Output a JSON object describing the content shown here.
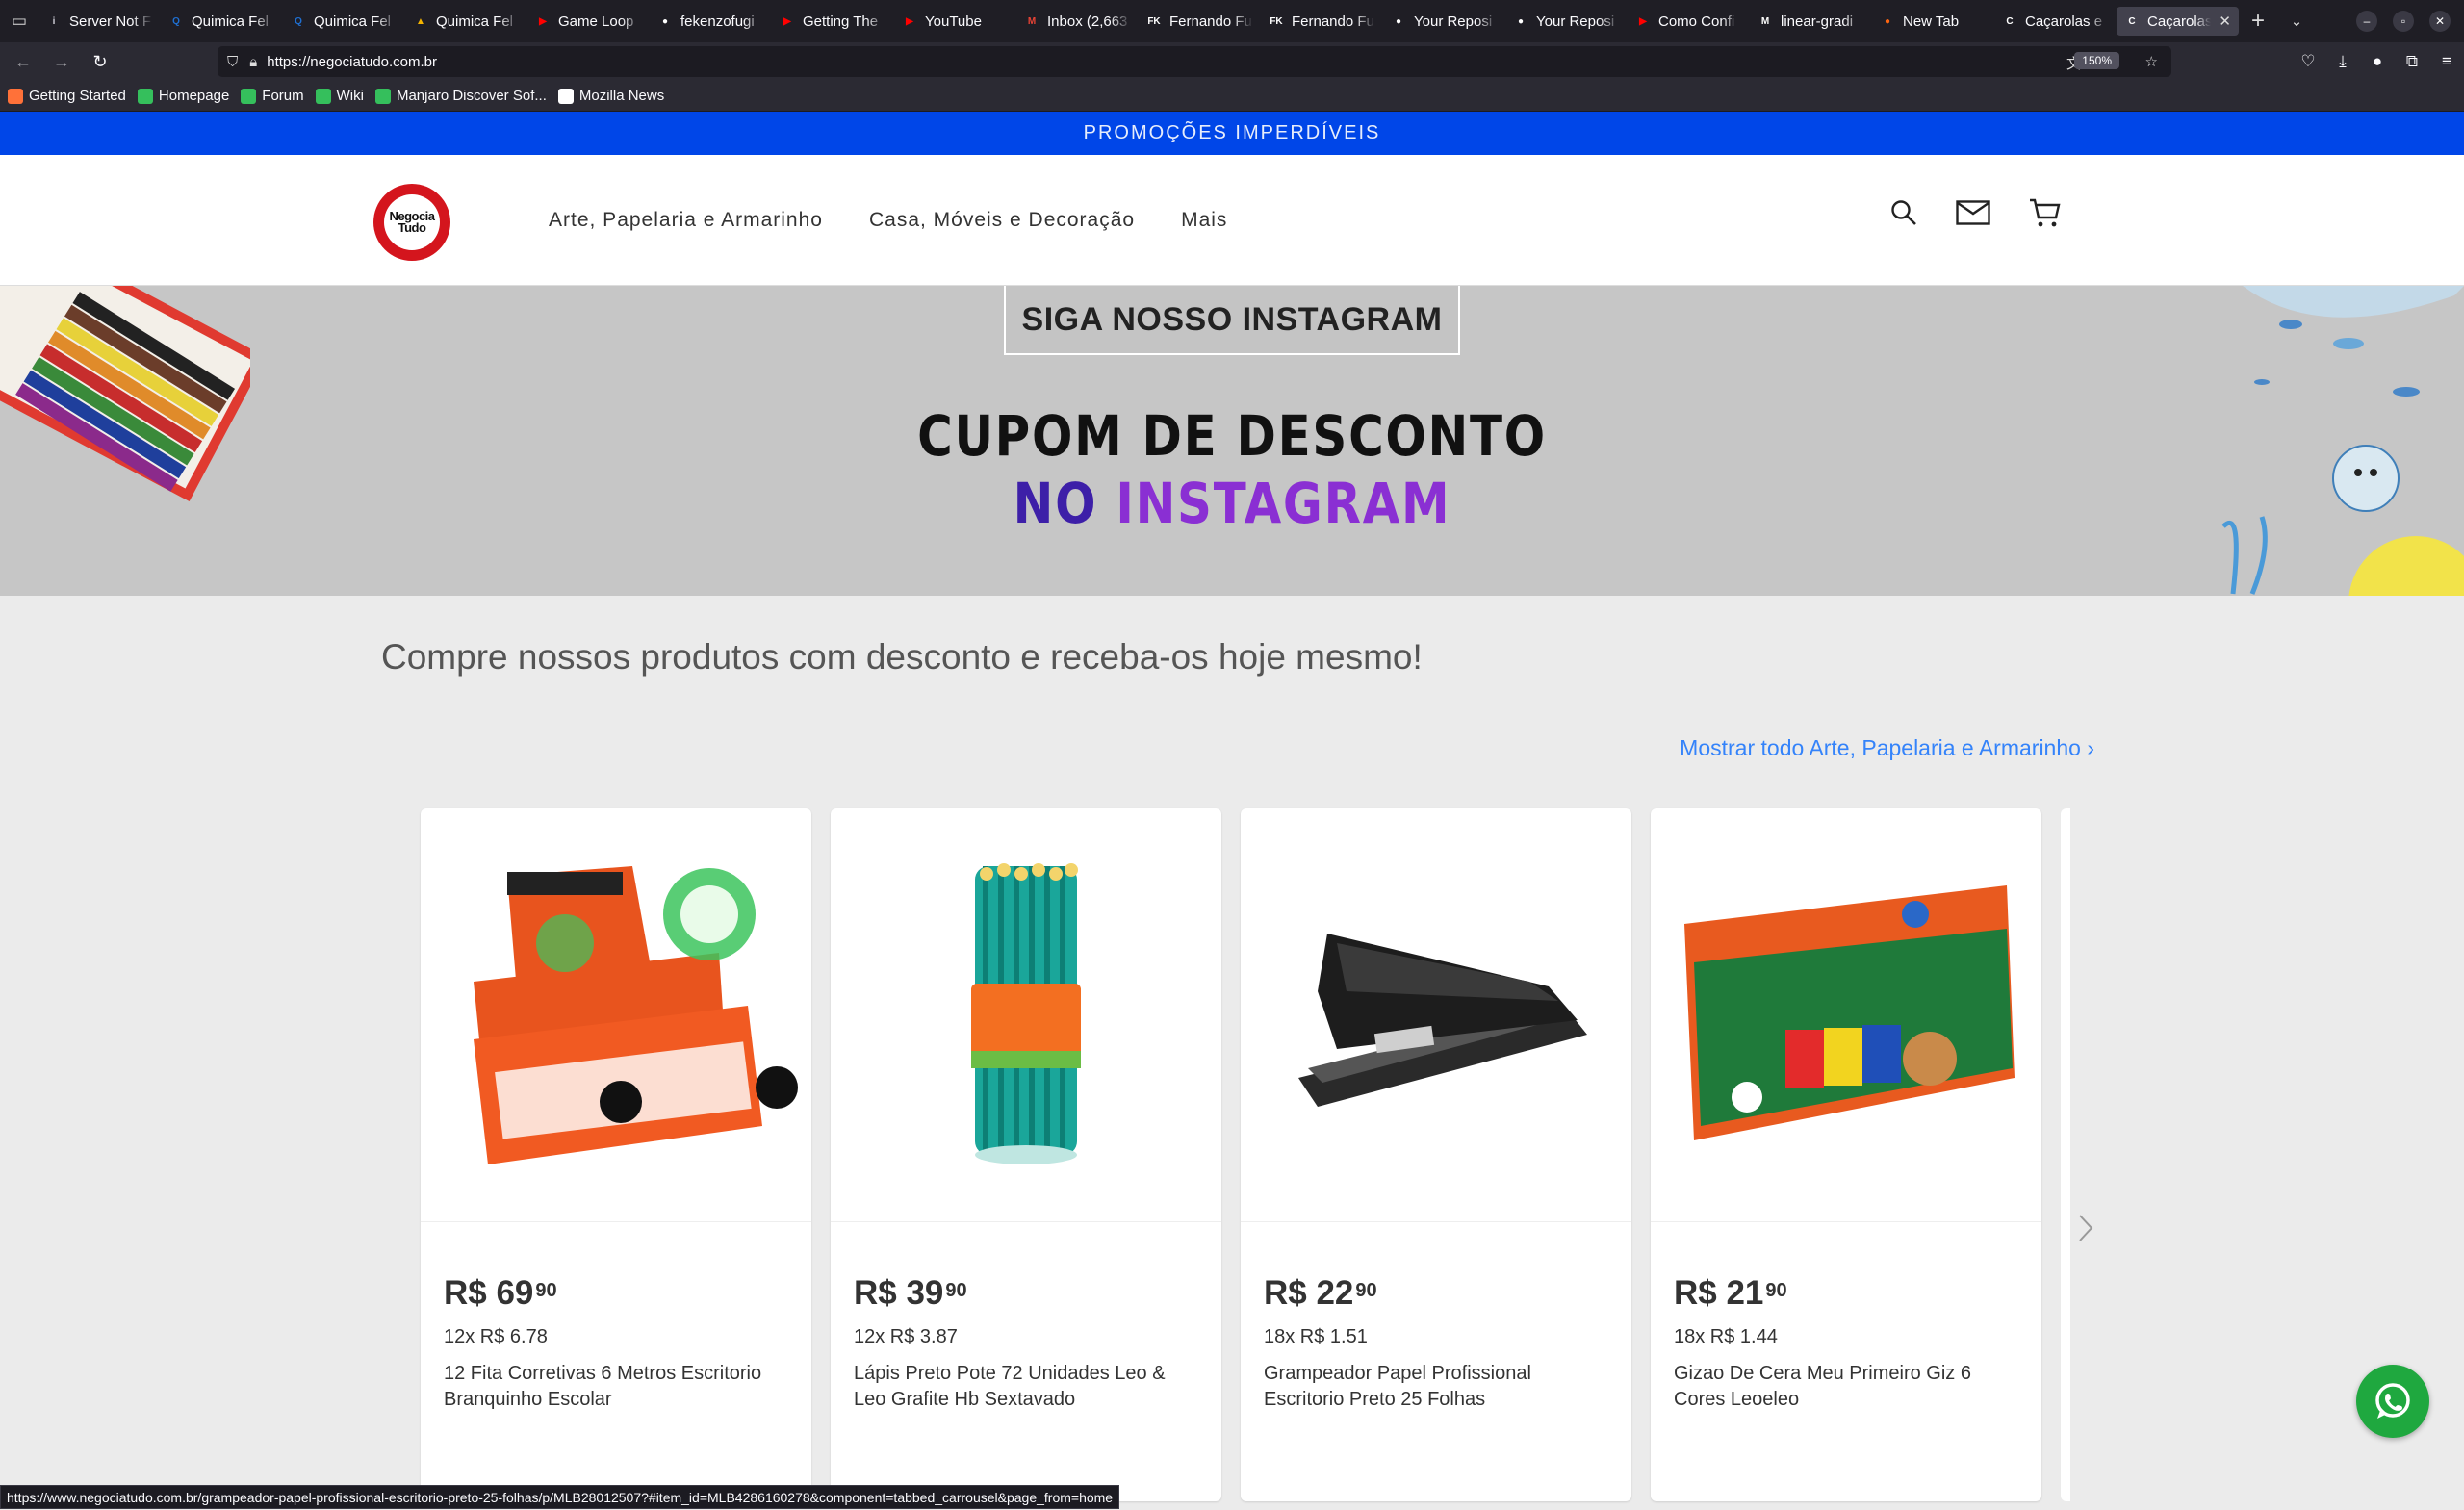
{
  "browser": {
    "tabs": [
      {
        "label": "Server Not F",
        "fav": "#cfcfd8",
        "glyph": "i"
      },
      {
        "label": "Quimica Fel",
        "fav": "#1f6fd1",
        "glyph": "Q"
      },
      {
        "label": "Quimica Fel",
        "fav": "#1f6fd1",
        "glyph": "Q"
      },
      {
        "label": "Quimica Fel",
        "fav": "#f4b400",
        "glyph": "▲"
      },
      {
        "label": "Game Loop",
        "fav": "#ff0000",
        "glyph": "▶"
      },
      {
        "label": "fekenzofugi",
        "fav": "#ffffff",
        "glyph": "●"
      },
      {
        "label": "Getting The",
        "fav": "#ff0000",
        "glyph": "▶"
      },
      {
        "label": "YouTube",
        "fav": "#ff0000",
        "glyph": "▶"
      },
      {
        "label": "Inbox (2,663",
        "fav": "#ea4335",
        "glyph": "M"
      },
      {
        "label": "Fernando Fu",
        "fav": "#ffffff",
        "glyph": "FK"
      },
      {
        "label": "Fernando Fu",
        "fav": "#ffffff",
        "glyph": "FK"
      },
      {
        "label": "Your Reposi",
        "fav": "#ffffff",
        "glyph": "●"
      },
      {
        "label": "Your Reposi",
        "fav": "#ffffff",
        "glyph": "●"
      },
      {
        "label": "Como Confi",
        "fav": "#ff0000",
        "glyph": "▶"
      },
      {
        "label": "linear-gradi",
        "fav": "#ffffff",
        "glyph": "M"
      },
      {
        "label": "New Tab",
        "fav": "#ff6611",
        "glyph": "●"
      },
      {
        "label": "Caçarolas e",
        "fav": "#ffffff",
        "glyph": "C"
      },
      {
        "label": "Caçarolas",
        "fav": "#ffffff",
        "glyph": "C",
        "active": true
      }
    ],
    "url": "https://negociatudo.com.br",
    "zoom": "150%",
    "bookmarks": [
      {
        "label": "Getting Started",
        "color": "#ff7139"
      },
      {
        "label": "Homepage",
        "color": "#35bf5c"
      },
      {
        "label": "Forum",
        "color": "#35bf5c"
      },
      {
        "label": "Wiki",
        "color": "#35bf5c"
      },
      {
        "label": "Manjaro Discover Sof...",
        "color": "#35bf5c"
      },
      {
        "label": "Mozilla News",
        "color": "#ffffff"
      }
    ],
    "status_url": "https://www.negociatudo.com.br/grampeador-papel-profissional-escritorio-preto-25-folhas/p/MLB28012507?#item_id=MLB4286160278&component=tabbed_carrousel&page_from=home"
  },
  "promo": {
    "text": "PROMOÇÕES IMPERDÍVEIS"
  },
  "header": {
    "logo_line1": "Negocia",
    "logo_line2": "Tudo",
    "menu": [
      "Arte, Papelaria e Armarinho",
      "Casa, Móveis e Decoração",
      "Mais"
    ],
    "icons": [
      "search-icon",
      "mail-icon",
      "cart-icon"
    ]
  },
  "banner": {
    "button": "SIGA NOSSO INSTAGRAM",
    "line1": "CUPOM DE DESCONTO",
    "line2a": "NO",
    "line2b": "INSTAGRAM"
  },
  "section": {
    "title": "Compre nossos produtos com desconto e receba-os hoje mesmo!",
    "show_all": "Mostrar todo Arte, Papelaria e Armarinho"
  },
  "products": [
    {
      "price": "R$ 69",
      "cents": "90",
      "installments": "12x R$ 6.78",
      "title": "12 Fita Corretivas 6 Metros Escritorio Branquinho Escolar"
    },
    {
      "price": "R$ 39",
      "cents": "90",
      "installments": "12x R$ 3.87",
      "title": "Lápis Preto Pote 72 Unidades Leo & Leo Grafite Hb Sextavado"
    },
    {
      "price": "R$ 22",
      "cents": "90",
      "installments": "18x R$ 1.51",
      "title": "Grampeador Papel Profissional Escritorio Preto 25 Folhas"
    },
    {
      "price": "R$ 21",
      "cents": "90",
      "installments": "18x R$ 1.44",
      "title": "Gizao De Cera Meu Primeiro Giz 6 Cores Leoeleo"
    }
  ],
  "colors": {
    "promo_bar": "#0046e8",
    "link": "#3483fa",
    "whatsapp": "#1fa83f",
    "logo_red": "#d4151d"
  }
}
